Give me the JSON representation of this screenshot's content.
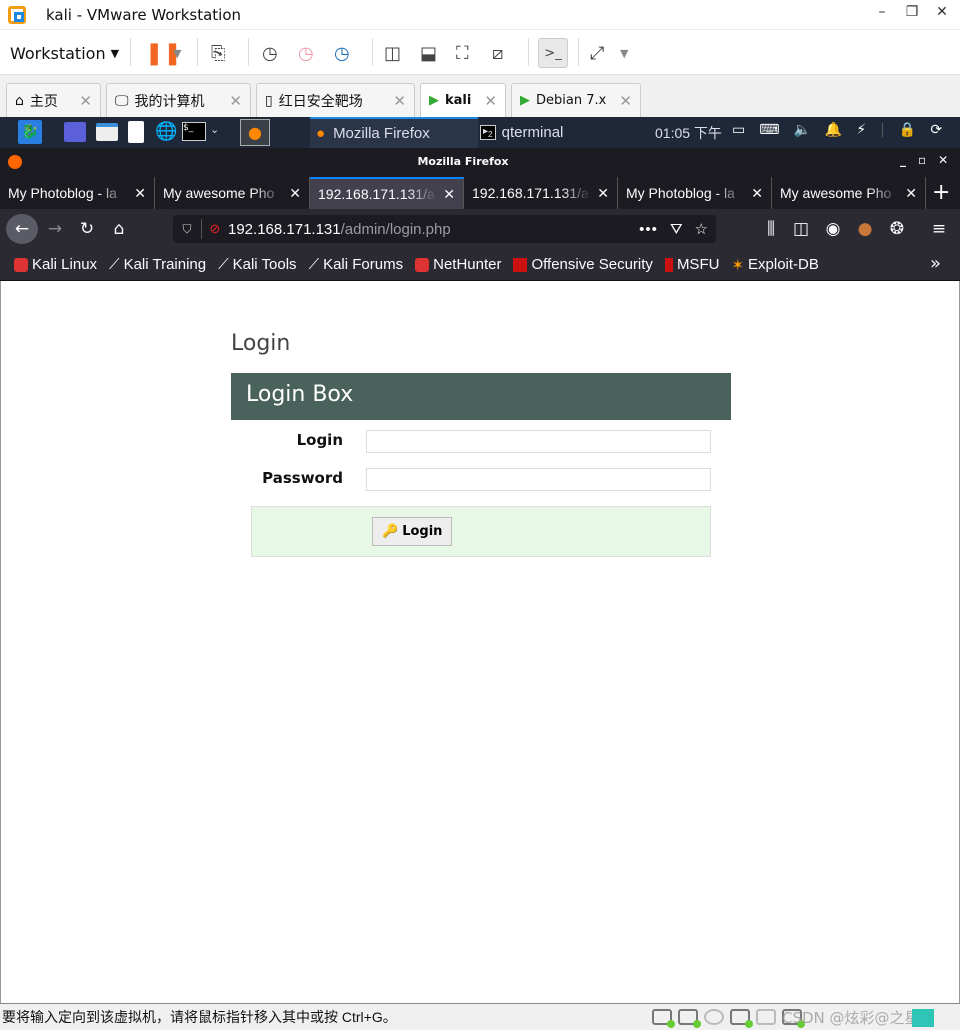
{
  "vmware": {
    "window_title": "kali - VMware Workstation",
    "menu_label": "Workstation",
    "tabs": [
      {
        "label": "主页",
        "icon": "home-icon"
      },
      {
        "label": "我的计算机",
        "icon": "monitor-icon"
      },
      {
        "label": "红日安全靶场",
        "icon": "document-icon"
      },
      {
        "label": "kali",
        "icon": "vm-running-icon",
        "active": true
      },
      {
        "label": "Debian 7.x",
        "icon": "vm-running-icon"
      }
    ],
    "status_text": "要将输入定向到该虚拟机，请将鼠标指针移入其中或按 Ctrl+G。",
    "watermark": "CSDN @炫彩@之星"
  },
  "kali_panel": {
    "tasks": [
      {
        "label": "Mozilla Firefox",
        "active": true
      },
      {
        "label": "qterminal",
        "badge": "2"
      }
    ],
    "clock": "01:05 下午"
  },
  "firefox": {
    "window_title": "Mozilla Firefox",
    "tabs": [
      {
        "label": "My Photoblog - la"
      },
      {
        "label": "My awesome Pho"
      },
      {
        "label": "192.168.171.131/a",
        "active": true
      },
      {
        "label": "192.168.171.131/a"
      },
      {
        "label": "My Photoblog - la"
      },
      {
        "label": "My awesome Pho"
      }
    ],
    "url_host": "192.168.171.131",
    "url_path": "/admin/login.php",
    "bookmarks": [
      "Kali Linux",
      "Kali Training",
      "Kali Tools",
      "Kali Forums",
      "NetHunter",
      "Offensive Security",
      "MSFU",
      "Exploit-DB"
    ],
    "accent": "#0a84ff"
  },
  "page": {
    "heading": "Login",
    "box_title": "Login Box",
    "box_color": "#4a625c",
    "login_label": "Login",
    "login_value": "",
    "password_label": "Password",
    "password_value": "",
    "submit_label": "Login"
  }
}
